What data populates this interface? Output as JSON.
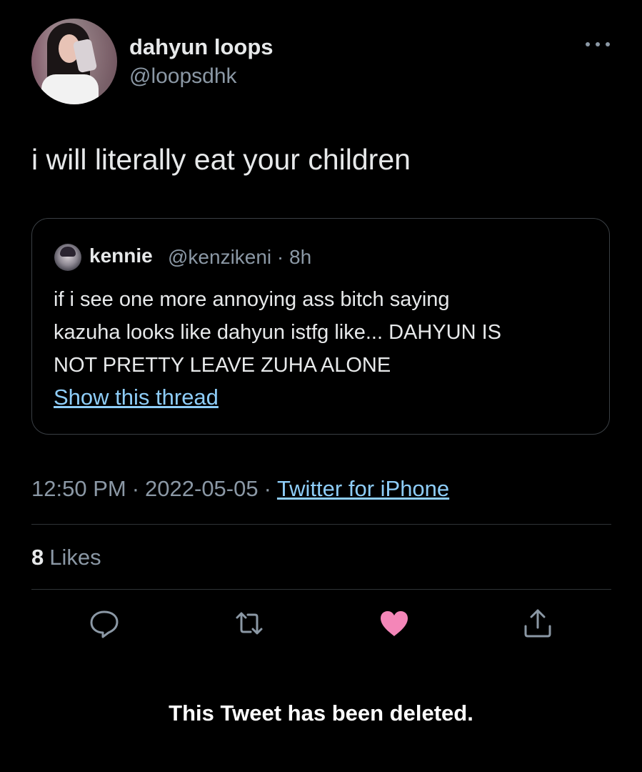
{
  "author": {
    "name": "dahyun loops",
    "handle": "@loopsdhk"
  },
  "tweet": {
    "text": "i will literally eat your children"
  },
  "quoted_tweet": {
    "name": "kennie",
    "handle_time": "@kenzikeni · 8h",
    "lines": [
      "if i see one more annoying ass bitch saying",
      "kazuha looks like dahyun istfg like... DAHYUN IS",
      "NOT PRETTY LEAVE ZUHA ALONE"
    ],
    "link_label": "Show this thread"
  },
  "meta": {
    "time": "12:50 PM",
    "date": "2022-05-05",
    "separator": "·",
    "source": "Twitter for iPhone"
  },
  "stats": {
    "likes_count": "8",
    "likes_label": "Likes"
  },
  "actions": {
    "reply_icon": "reply-icon",
    "retweet_icon": "retweet-icon",
    "like_icon": "heart-icon",
    "share_icon": "share-icon",
    "like_color": "#f91880"
  },
  "status": {
    "deleted_notice": "This Tweet has been deleted."
  }
}
